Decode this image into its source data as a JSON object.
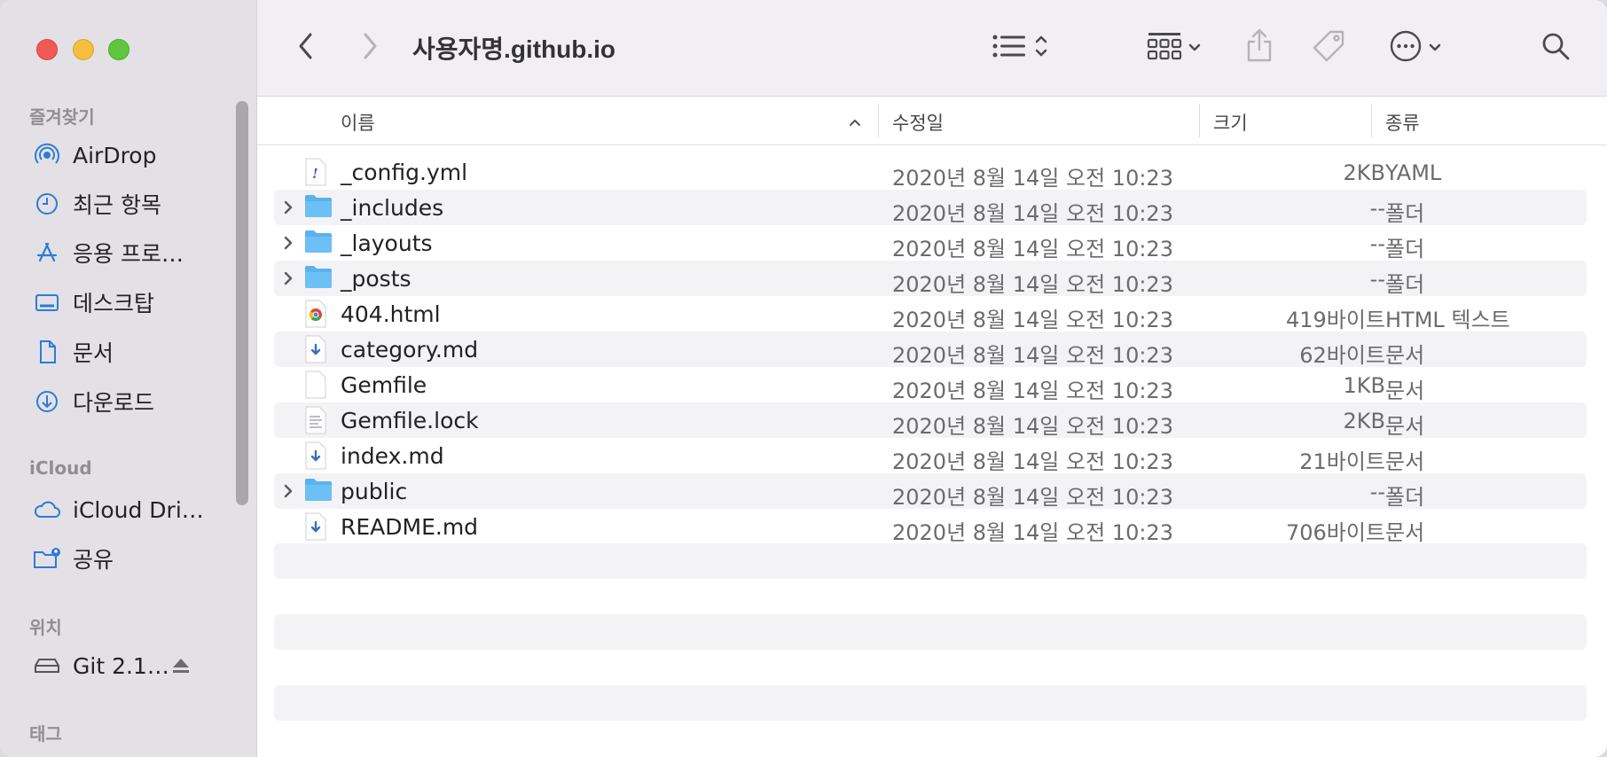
{
  "window": {
    "title": "사용자명.github.io"
  },
  "colors": {
    "close": "#ee5b55",
    "minimize": "#f6be3e",
    "zoom": "#5fc63f",
    "accent": "#2e7bd6",
    "folder": "#5ab2ef"
  },
  "sidebar": {
    "sections": {
      "favorites": "즐겨찾기",
      "icloud": "iCloud",
      "locations": "위치",
      "tags": "태그"
    },
    "favorites": [
      {
        "label": "AirDrop",
        "icon": "airdrop-icon"
      },
      {
        "label": "최근 항목",
        "icon": "clock-icon"
      },
      {
        "label": "응용 프로…",
        "icon": "applications-icon"
      },
      {
        "label": "데스크탑",
        "icon": "desktop-icon"
      },
      {
        "label": "문서",
        "icon": "document-icon"
      },
      {
        "label": "다운로드",
        "icon": "download-icon"
      }
    ],
    "icloud": [
      {
        "label": "iCloud Dri…",
        "icon": "cloud-icon"
      },
      {
        "label": "공유",
        "icon": "shared-folder-icon"
      }
    ],
    "locations": [
      {
        "label": "Git 2.1…",
        "icon": "disk-icon"
      }
    ]
  },
  "columns": {
    "name": "이름",
    "modified": "수정일",
    "size": "크기",
    "kind": "종류"
  },
  "files": [
    {
      "name": "_config.yml",
      "date": "2020년 8월 14일 오전 10:23",
      "size": "2KB",
      "kind": "YAML",
      "type": "yaml",
      "folder": false
    },
    {
      "name": "_includes",
      "date": "2020년 8월 14일 오전 10:23",
      "size": "--",
      "kind": "폴더",
      "type": "folder",
      "folder": true
    },
    {
      "name": "_layouts",
      "date": "2020년 8월 14일 오전 10:23",
      "size": "--",
      "kind": "폴더",
      "type": "folder",
      "folder": true
    },
    {
      "name": "_posts",
      "date": "2020년 8월 14일 오전 10:23",
      "size": "--",
      "kind": "폴더",
      "type": "folder",
      "folder": true
    },
    {
      "name": "404.html",
      "date": "2020년 8월 14일 오전 10:23",
      "size": "419바이트",
      "kind": "HTML 텍스트",
      "type": "html",
      "folder": false
    },
    {
      "name": "category.md",
      "date": "2020년 8월 14일 오전 10:23",
      "size": "62바이트",
      "kind": "문서",
      "type": "md",
      "folder": false
    },
    {
      "name": "Gemfile",
      "date": "2020년 8월 14일 오전 10:23",
      "size": "1KB",
      "kind": "문서",
      "type": "blank",
      "folder": false
    },
    {
      "name": "Gemfile.lock",
      "date": "2020년 8월 14일 오전 10:23",
      "size": "2KB",
      "kind": "문서",
      "type": "text",
      "folder": false
    },
    {
      "name": "index.md",
      "date": "2020년 8월 14일 오전 10:23",
      "size": "21바이트",
      "kind": "문서",
      "type": "md",
      "folder": false
    },
    {
      "name": "public",
      "date": "2020년 8월 14일 오전 10:23",
      "size": "--",
      "kind": "폴더",
      "type": "folder",
      "folder": true
    },
    {
      "name": "README.md",
      "date": "2020년 8월 14일 오전 10:23",
      "size": "706바이트",
      "kind": "문서",
      "type": "md",
      "folder": false
    }
  ]
}
